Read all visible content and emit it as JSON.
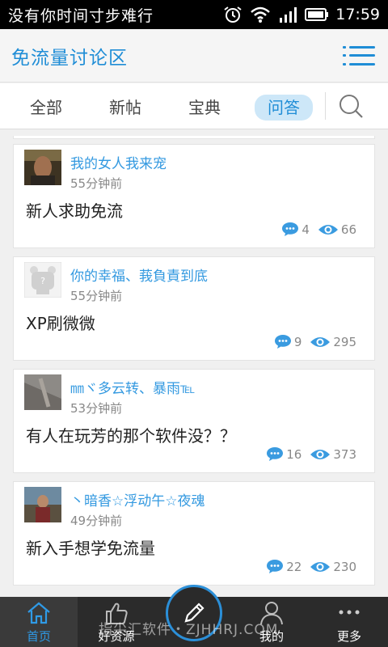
{
  "status_bar": {
    "text": "没有你时间寸步难行",
    "time": "17:59",
    "icons": [
      "alarm-icon",
      "wifi-icon",
      "signal-icon",
      "battery-icon"
    ]
  },
  "header": {
    "title": "免流量讨论区",
    "menu_icon": "menu-icon"
  },
  "tabs": [
    {
      "label": "全部",
      "active": false
    },
    {
      "label": "新帖",
      "active": false
    },
    {
      "label": "宝典",
      "active": false
    },
    {
      "label": "问答",
      "active": true
    }
  ],
  "search_icon": "search-icon",
  "posts": [
    {
      "user": "我的女人我来宠",
      "time": "55分钟前",
      "title": "新人求助免流",
      "comments": "4",
      "views": "66"
    },
    {
      "user": "你的幸福、莪負責到底",
      "time": "55分钟前",
      "title": "XP刷微微",
      "comments": "9",
      "views": "295"
    },
    {
      "user": "㎜ヾ多云转、暴雨℡",
      "time": "53分钟前",
      "title": "有人在玩芳的那个软件没？？",
      "comments": "16",
      "views": "373"
    },
    {
      "user": "丶暗香☆浮动午☆夜魂",
      "time": "49分钟前",
      "title": "新入手想学免流量",
      "comments": "22",
      "views": "230"
    }
  ],
  "bottom_nav": [
    {
      "label": "首页",
      "icon": "home-icon",
      "active": true
    },
    {
      "label": "好资源",
      "icon": "thumbs-up-icon",
      "active": false
    },
    {
      "label": "",
      "icon": "pencil-icon",
      "active": false
    },
    {
      "label": "我的",
      "icon": "user-icon",
      "active": false
    },
    {
      "label": "更多",
      "icon": "more-icon",
      "active": false
    }
  ],
  "watermark": "指尖汇软件・ZJHHRJ.COM",
  "colors": {
    "accent": "#1f8dd6",
    "tab_active_bg": "#cde7f8",
    "nav_bg": "#2b2b2b"
  }
}
